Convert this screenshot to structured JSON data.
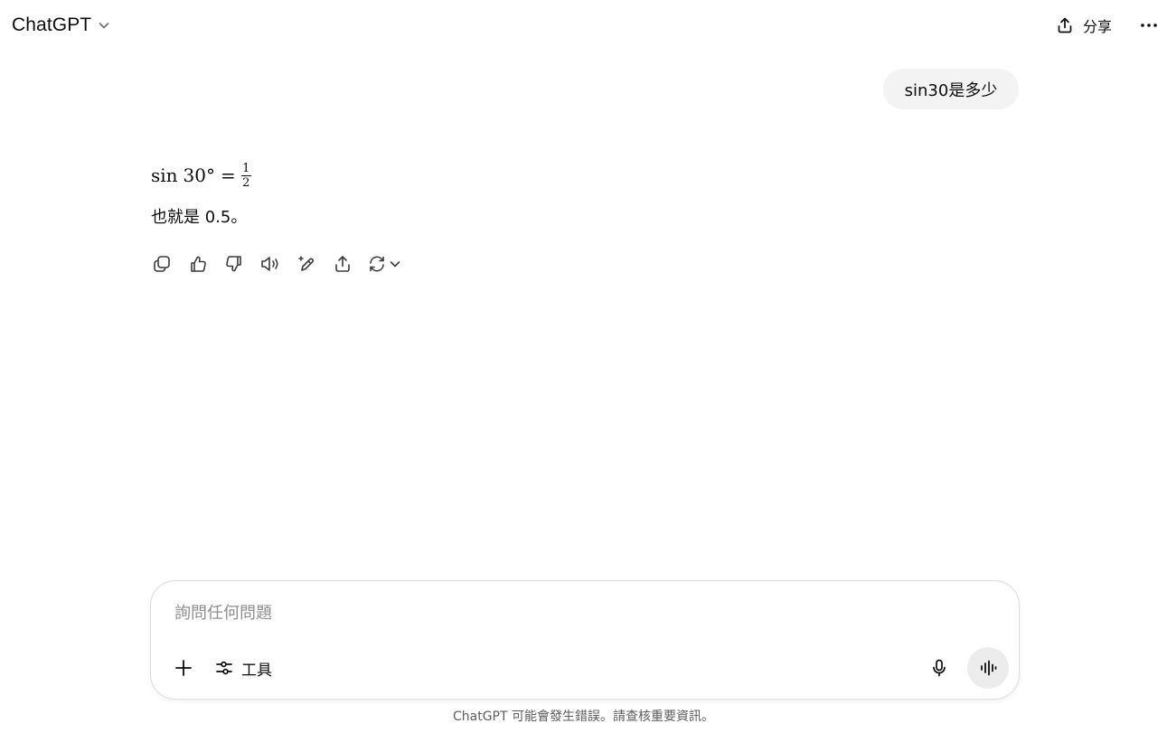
{
  "header": {
    "model_name": "ChatGPT",
    "share_label": "分享",
    "icons": {
      "model_chevron": "chevron-down-icon",
      "share": "share-icon",
      "more": "more-horizontal-icon"
    }
  },
  "conversation": {
    "user_message": "sin30是多少",
    "assistant": {
      "math": {
        "func": "sin",
        "arg": "30°",
        "equals": "=",
        "numerator": "1",
        "denominator": "2"
      },
      "answer_text": "也就是 0.5。"
    },
    "actions": [
      {
        "name": "copy-icon"
      },
      {
        "name": "thumbs-up-icon"
      },
      {
        "name": "thumbs-down-icon"
      },
      {
        "name": "read-aloud-icon"
      },
      {
        "name": "edit-in-canvas-icon"
      },
      {
        "name": "share-icon"
      },
      {
        "name": "regenerate-icon"
      }
    ]
  },
  "composer": {
    "placeholder": "詢問任何問題",
    "value": "",
    "tools_label": "工具",
    "icons": {
      "add": "plus-icon",
      "tools": "sliders-icon",
      "mic": "microphone-icon",
      "voice": "voice-mode-icon"
    }
  },
  "footer": {
    "disclaimer": "ChatGPT 可能會發生錯誤。請查核重要資訊。"
  },
  "colors": {
    "text": "#0d0d0d",
    "user_bubble_bg": "#f3f3f3",
    "placeholder": "#8f8f8f",
    "voice_button_bg": "#ececec",
    "composer_border": "#dcdcdc",
    "disclaimer": "#5d5d5d"
  }
}
